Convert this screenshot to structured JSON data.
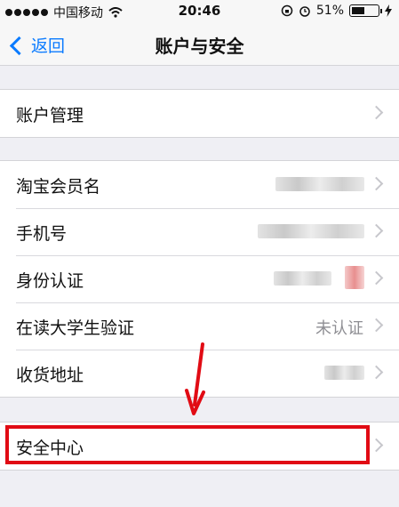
{
  "status_bar": {
    "carrier": "中国移动",
    "time": "20:46",
    "battery": "51%",
    "battery_level": 0.51
  },
  "nav": {
    "back_label": "返回",
    "title": "账户与安全"
  },
  "groups": {
    "account": {
      "manage_label": "账户管理"
    },
    "info": {
      "member_label": "淘宝会员名",
      "phone_label": "手机号",
      "identity_label": "身份认证",
      "student_label": "在读大学生验证",
      "student_value": "未认证",
      "address_label": "收货地址"
    },
    "security": {
      "center_label": "安全中心"
    }
  },
  "colors": {
    "accent": "#0b7bff",
    "highlight": "#e10b14",
    "background": "#efeff4"
  }
}
